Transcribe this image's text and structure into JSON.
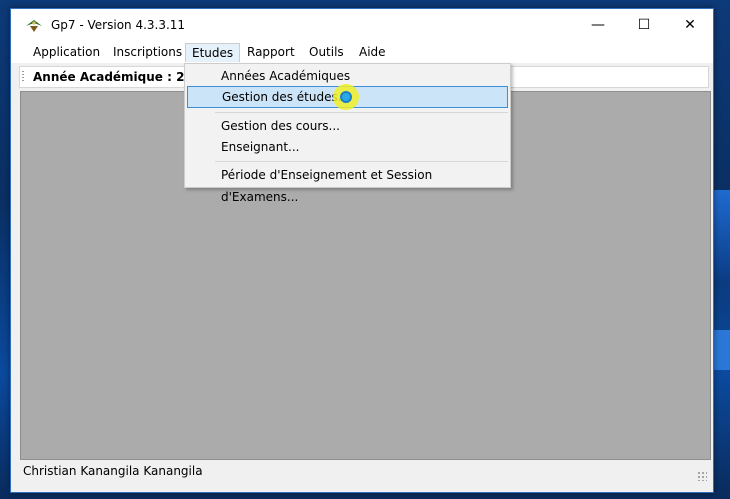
{
  "window": {
    "title": "Gp7 - Version 4.3.3.11",
    "minimize_glyph": "—",
    "maximize_glyph": "☐",
    "close_glyph": "✕"
  },
  "menubar": {
    "items": [
      {
        "label": "Application"
      },
      {
        "label": "Inscriptions"
      },
      {
        "label": "Etudes"
      },
      {
        "label": "Rapport"
      },
      {
        "label": "Outils"
      },
      {
        "label": "Aide"
      }
    ]
  },
  "toolbar": {
    "academic_year_label": "Année Académique : 2015 -"
  },
  "dropdown": {
    "items": [
      {
        "label": "Années Académiques"
      },
      {
        "label": "Gestion des études..."
      },
      {
        "label": "Gestion des cours..."
      },
      {
        "label": "Enseignant..."
      },
      {
        "label": "Période d'Enseignement et Session d'Examens..."
      }
    ],
    "highlighted": "Gestion des études..."
  },
  "statusbar": {
    "user": "Christian Kanangila Kanangila"
  },
  "colors": {
    "mdi_background": "#ababab",
    "highlight": "#cce4f7",
    "highlight_border": "#3a8fd8",
    "cursor_ring": "#f0f028",
    "cursor_dot": "#29a9e9"
  }
}
